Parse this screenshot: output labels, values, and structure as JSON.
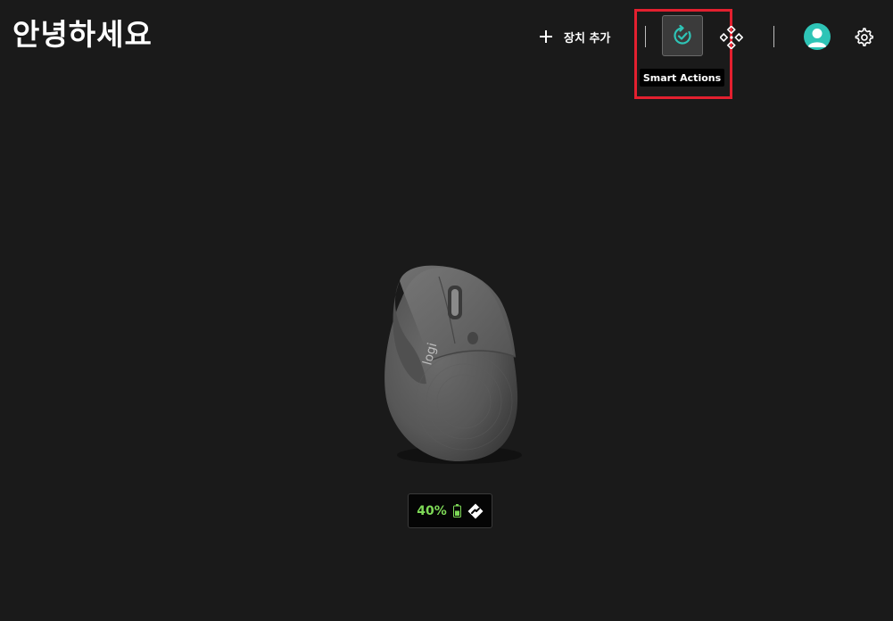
{
  "header": {
    "greeting": "안녕하세요",
    "add_device_label": "장치 추가",
    "smart_actions_tooltip": "Smart Actions",
    "icons": {
      "add": "plus-icon",
      "smart_actions": "smart-actions-icon",
      "flow": "flow-icon",
      "account": "user-avatar-icon",
      "settings": "gear-icon"
    }
  },
  "device": {
    "name": "logi",
    "battery": {
      "level": 40,
      "label": "40%",
      "icon": "battery-icon",
      "connection_icon": "logi-bolt-icon"
    }
  },
  "colors": {
    "background": "#1a1a1a",
    "accent": "#2ec4b6",
    "battery": "#7ed957",
    "highlight": "#e3202f"
  }
}
